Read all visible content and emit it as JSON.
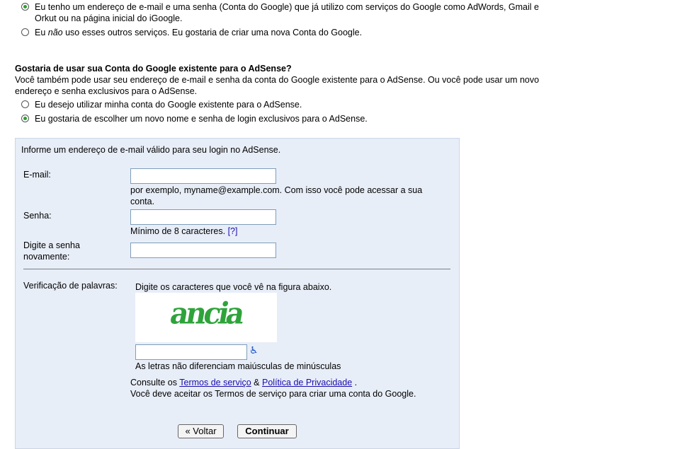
{
  "account_choice": {
    "option_existing": "Eu tenho um endereço de e-mail e uma senha (Conta do Google) que já utilizo com serviços do Google como AdWords, Gmail e",
    "option_existing_cont": "Orkut ou na página inicial do iGoogle.",
    "option_new_pre": "Eu ",
    "option_new_em": "não",
    "option_new_post": " uso esses outros serviços. Eu gostaria de criar uma nova Conta do Google."
  },
  "adsense_question": {
    "heading": "Gostaria de usar sua Conta do Google existente para o AdSense?",
    "desc_line1": "Você também pode usar seu endereço de e-mail e senha da conta do Google existente para o AdSense. Ou você pode usar um novo",
    "desc_line2": "endereço e senha exclusivos para o AdSense.",
    "option_use_existing": "Eu desejo utilizar minha conta do Google existente para o AdSense.",
    "option_new_login": "Eu gostaria de escolher um novo nome e senha de login exclusivos para o AdSense."
  },
  "form": {
    "intro": "Informe um endereço de e-mail válido para seu login no AdSense.",
    "email_label": "E-mail:",
    "email_value": "",
    "email_hint_1": "por exemplo, myname@example.com. Com isso você pode acessar a sua",
    "email_hint_2": "conta.",
    "password_label": "Senha:",
    "password_value": "",
    "password_hint": "Mínimo de 8 caracteres.",
    "password_help": "[?]",
    "confirm_label_1": "Digite a senha",
    "confirm_label_2": "novamente:",
    "confirm_value": "",
    "verification_label": "Verificação de palavras:",
    "verification_instructions": "Digite os caracteres que você vê na figura abaixo.",
    "captcha_text": "ancia",
    "captcha_value": "",
    "captcha_note": "As letras não diferenciam maiúsculas de minúsculas",
    "terms_pre": "Consulte os ",
    "terms_link": "Termos de serviço",
    "terms_amp": " & ",
    "privacy_link": "Política de Privacidade",
    "terms_post": " .",
    "terms_accept": "Você deve aceitar os Termos de serviço para criar uma conta do Google.",
    "back_button": "« Voltar",
    "continue_button": "Continuar"
  }
}
